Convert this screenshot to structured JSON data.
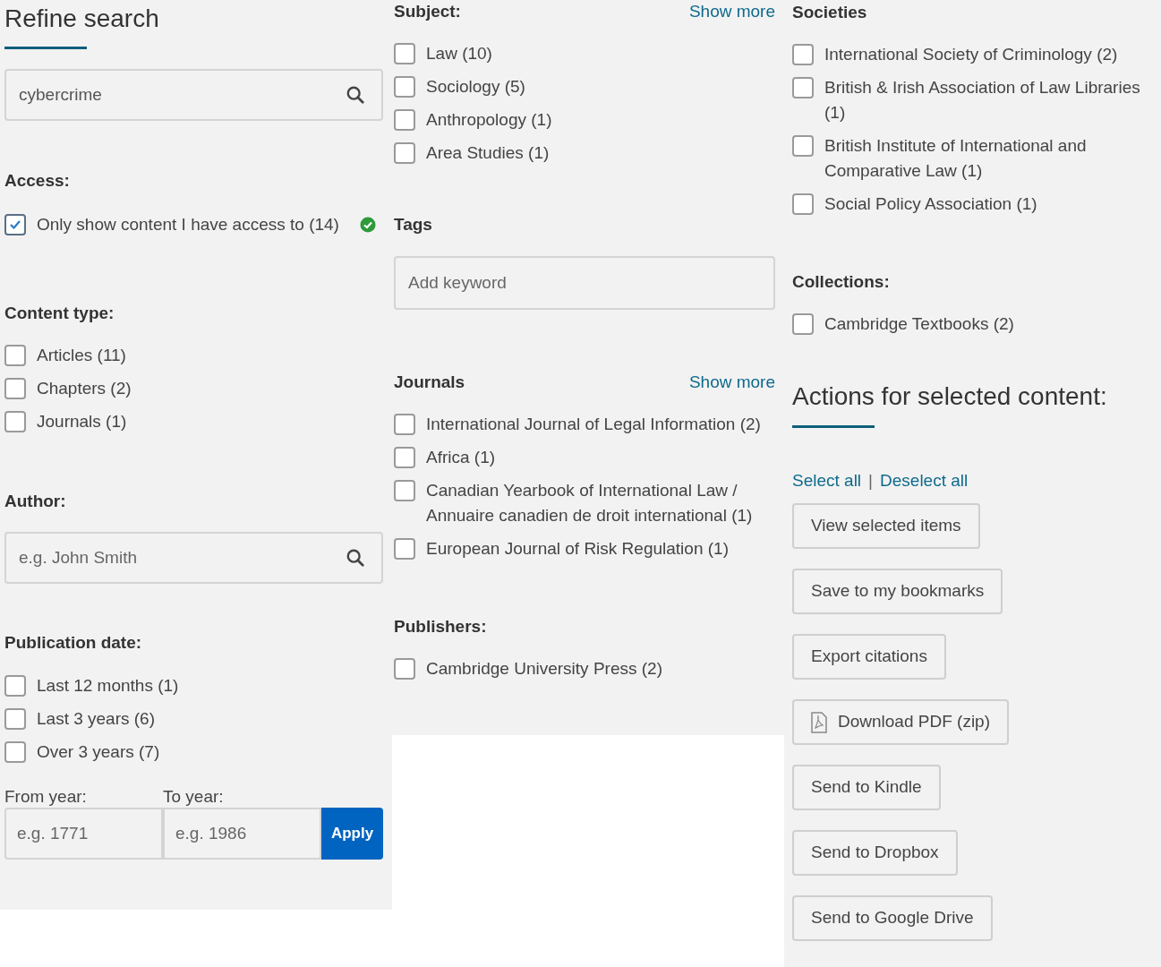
{
  "refine": {
    "title": "Refine search",
    "search": {
      "value": "cybercrime"
    }
  },
  "access": {
    "heading": "Access:",
    "option": {
      "label": "Only show content I have access to (14)",
      "checked": true
    }
  },
  "content_type": {
    "heading": "Content type:",
    "options": [
      {
        "label": "Articles (11)",
        "checked": false
      },
      {
        "label": "Chapters (2)",
        "checked": false
      },
      {
        "label": "Journals (1)",
        "checked": false
      }
    ]
  },
  "author": {
    "heading": "Author:",
    "placeholder": "e.g. John Smith"
  },
  "publication_date": {
    "heading": "Publication date:",
    "options": [
      {
        "label": "Last 12 months (1)",
        "checked": false
      },
      {
        "label": "Last 3 years (6)",
        "checked": false
      },
      {
        "label": "Over 3 years (7)",
        "checked": false
      }
    ],
    "from": {
      "label": "From year:",
      "placeholder": "e.g. 1771"
    },
    "to": {
      "label": "To year:",
      "placeholder": "e.g. 1986"
    },
    "apply": "Apply"
  },
  "subject": {
    "heading": "Subject:",
    "show_more": "Show more",
    "options": [
      {
        "label": "Law (10)",
        "checked": false
      },
      {
        "label": "Sociology (5)",
        "checked": false
      },
      {
        "label": "Anthropology (1)",
        "checked": false
      },
      {
        "label": "Area Studies (1)",
        "checked": false
      }
    ]
  },
  "tags": {
    "heading": "Tags",
    "placeholder": "Add keyword"
  },
  "journals": {
    "heading": "Journals",
    "show_more": "Show more",
    "options": [
      {
        "label": "International Journal of Legal Information (2)",
        "checked": false
      },
      {
        "label": "Africa (1)",
        "checked": false
      },
      {
        "label": "Canadian Yearbook of International Law / Annuaire canadien de droit international (1)",
        "checked": false
      },
      {
        "label": "European Journal of Risk Regulation (1)",
        "checked": false
      }
    ]
  },
  "publishers": {
    "heading": "Publishers:",
    "options": [
      {
        "label": "Cambridge University Press (2)",
        "checked": false
      }
    ]
  },
  "societies": {
    "heading": "Societies",
    "options": [
      {
        "label": "International Society of Criminology (2)",
        "checked": false
      },
      {
        "label": "British & Irish Association of Law Libraries (1)",
        "checked": false
      },
      {
        "label": "British Institute of International and Comparative Law (1)",
        "checked": false
      },
      {
        "label": "Social Policy Association (1)",
        "checked": false
      }
    ]
  },
  "collections": {
    "heading": "Collections:",
    "options": [
      {
        "label": "Cambridge Textbooks (2)",
        "checked": false
      }
    ]
  },
  "actions": {
    "title": "Actions for selected content:",
    "select_all": "Select all",
    "separator": "|",
    "deselect_all": "Deselect all",
    "buttons": [
      {
        "label": "View selected items",
        "kind": "plain"
      },
      {
        "label": "Save to my bookmarks",
        "kind": "plain"
      },
      {
        "label": "Export citations",
        "kind": "plain"
      },
      {
        "label": "Download PDF (zip)",
        "kind": "pdf"
      },
      {
        "label": "Send to Kindle",
        "kind": "plain"
      },
      {
        "label": "Send to Dropbox",
        "kind": "plain"
      },
      {
        "label": "Send to Google Drive",
        "kind": "plain"
      }
    ]
  }
}
